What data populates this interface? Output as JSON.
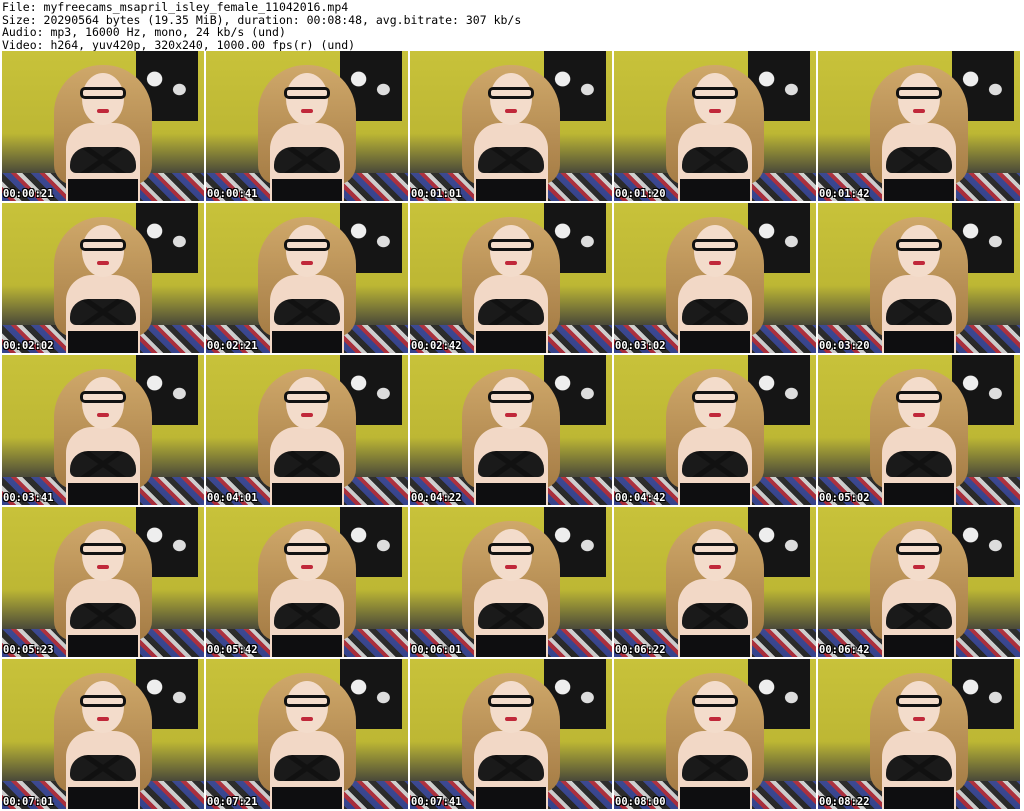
{
  "header": {
    "file_line": "File: myfreecams_msapril_isley_female_11042016.mp4",
    "size_line": "Size: 20290564 bytes (19.35 MiB), duration: 00:08:48, avg.bitrate: 307 kb/s",
    "audio_line": "Audio: mp3, 16000 Hz, mono, 24 kb/s (und)",
    "video_line": "Video: h264, yuv420p, 320x240, 1000.00 fps(r) (und)"
  },
  "thumbnails": [
    {
      "timestamp": "00:00:21"
    },
    {
      "timestamp": "00:00:41"
    },
    {
      "timestamp": "00:01:01"
    },
    {
      "timestamp": "00:01:20"
    },
    {
      "timestamp": "00:01:42"
    },
    {
      "timestamp": "00:02:02"
    },
    {
      "timestamp": "00:02:21"
    },
    {
      "timestamp": "00:02:42"
    },
    {
      "timestamp": "00:03:02"
    },
    {
      "timestamp": "00:03:20"
    },
    {
      "timestamp": "00:03:41"
    },
    {
      "timestamp": "00:04:01"
    },
    {
      "timestamp": "00:04:22"
    },
    {
      "timestamp": "00:04:42"
    },
    {
      "timestamp": "00:05:02"
    },
    {
      "timestamp": "00:05:23"
    },
    {
      "timestamp": "00:05:42"
    },
    {
      "timestamp": "00:06:01"
    },
    {
      "timestamp": "00:06:22"
    },
    {
      "timestamp": "00:06:42"
    },
    {
      "timestamp": "00:07:01"
    },
    {
      "timestamp": "00:07:21"
    },
    {
      "timestamp": "00:07:41"
    },
    {
      "timestamp": "00:08:00"
    },
    {
      "timestamp": "00:08:22"
    }
  ]
}
